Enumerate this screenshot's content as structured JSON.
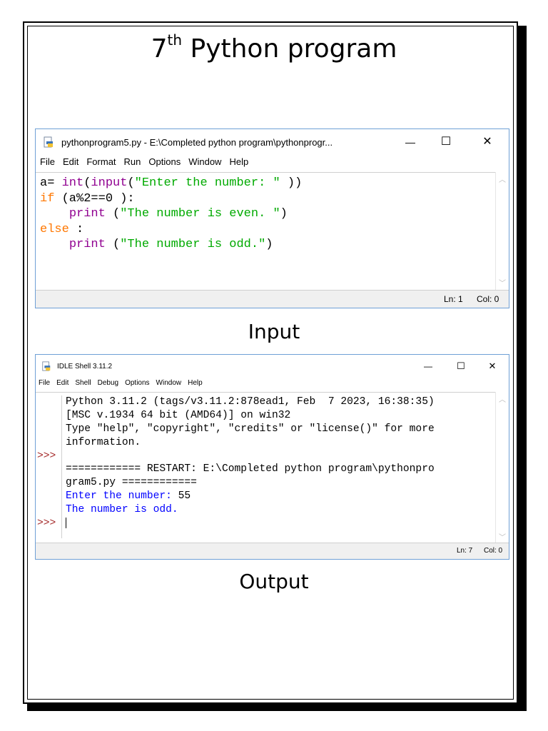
{
  "page": {
    "title_main": "7",
    "title_sup": "th",
    "title_rest": " Python program",
    "caption_input": "Input",
    "caption_output": "Output"
  },
  "editor_window": {
    "title": "pythonprogram5.py - E:\\Completed python program\\pythonprogr...",
    "controls": {
      "minimize": "—",
      "maximize": "☐",
      "close": "✕"
    },
    "menu": [
      "File",
      "Edit",
      "Format",
      "Run",
      "Options",
      "Window",
      "Help"
    ],
    "code_lines": [
      [
        {
          "t": "a= ",
          "c": "plain"
        },
        {
          "t": "int",
          "c": "bi"
        },
        {
          "t": "(",
          "c": "plain"
        },
        {
          "t": "input",
          "c": "bi"
        },
        {
          "t": "(",
          "c": "plain"
        },
        {
          "t": "\"Enter the number: \"",
          "c": "str"
        },
        {
          "t": " ))",
          "c": "plain"
        }
      ],
      [
        {
          "t": "if",
          "c": "kw"
        },
        {
          "t": " (a%2==0 ):",
          "c": "plain"
        }
      ],
      [
        {
          "t": "    ",
          "c": "plain"
        },
        {
          "t": "print",
          "c": "bi"
        },
        {
          "t": " (",
          "c": "plain"
        },
        {
          "t": "\"The number is even. \"",
          "c": "str"
        },
        {
          "t": ")",
          "c": "plain"
        }
      ],
      [
        {
          "t": "else",
          "c": "kw"
        },
        {
          "t": " :",
          "c": "plain"
        }
      ],
      [
        {
          "t": "    ",
          "c": "plain"
        },
        {
          "t": "print",
          "c": "bi"
        },
        {
          "t": " (",
          "c": "plain"
        },
        {
          "t": "\"The number is odd.\"",
          "c": "str"
        },
        {
          "t": ")",
          "c": "plain"
        }
      ]
    ],
    "status_ln": "Ln: 1",
    "status_col": "Col: 0"
  },
  "shell_window": {
    "title": "IDLE Shell 3.11.2",
    "controls": {
      "minimize": "—",
      "maximize": "☐",
      "close": "✕"
    },
    "menu": [
      "File",
      "Edit",
      "Shell",
      "Debug",
      "Options",
      "Window",
      "Help"
    ],
    "prompt": ">>>",
    "lines": [
      {
        "text": "Python 3.11.2 (tags/v3.11.2:878ead1, Feb  7 2023, 16:38:35)",
        "c": "plain",
        "prompt": false
      },
      {
        "text": "[MSC v.1934 64 bit (AMD64)] on win32",
        "c": "plain",
        "prompt": false
      },
      {
        "text": "Type \"help\", \"copyright\", \"credits\" or \"license()\" for more",
        "c": "plain",
        "prompt": false
      },
      {
        "text": "information.",
        "c": "plain",
        "prompt": false
      },
      {
        "text": "",
        "c": "plain",
        "prompt": true
      },
      {
        "text": "============ RESTART: E:\\Completed python program\\pythonpro",
        "c": "plain",
        "prompt": false
      },
      {
        "text": "gram5.py ============",
        "c": "plain",
        "prompt": false
      },
      {
        "text": "Enter the number: ",
        "c": "out",
        "suffix": "55",
        "prompt": false
      },
      {
        "text": "The number is odd.",
        "c": "out",
        "prompt": false
      },
      {
        "text": "",
        "c": "plain",
        "prompt": true,
        "cursor": true
      }
    ],
    "status_ln": "Ln: 7",
    "status_col": "Col: 0"
  },
  "colors": {
    "keyword": "#ff7700",
    "builtin": "#900090",
    "string": "#00aa00",
    "output": "#0000ff",
    "prompt": "#a52a2a",
    "window_border": "#6fa0d6"
  }
}
